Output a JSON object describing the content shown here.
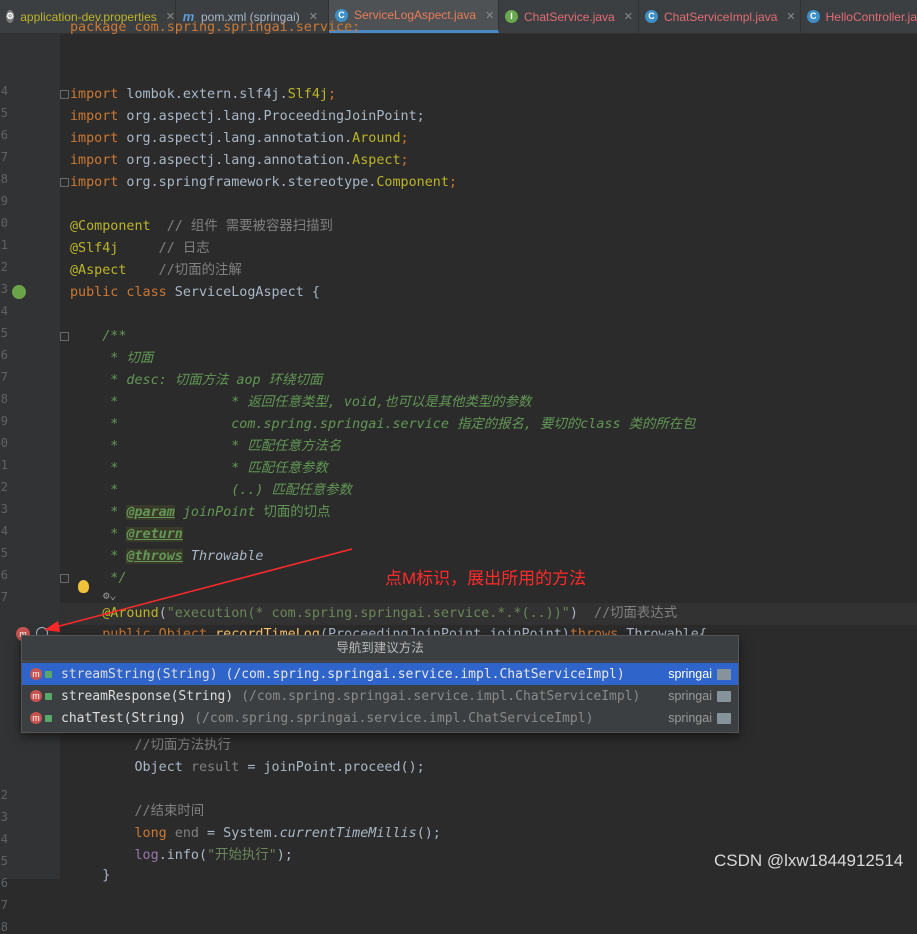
{
  "tabs": [
    {
      "label": "application-dev.properties",
      "color": "#bbb529",
      "icon": "gear-icon",
      "icon_text": "",
      "active": false
    },
    {
      "label": "pom.xml (springai)",
      "color": "#a9b7c6",
      "icon": "maven-icon",
      "icon_text": "m",
      "active": false
    },
    {
      "label": "ServiceLogAspect.java",
      "color": "#e87d59",
      "icon": "class-icon",
      "icon_text": "C",
      "active": true
    },
    {
      "label": "ChatService.java",
      "color": "#e06c75",
      "icon": "interface-icon",
      "icon_text": "I",
      "active": false
    },
    {
      "label": "ChatServiceImpl.java",
      "color": "#e06c75",
      "icon": "class-icon",
      "icon_text": "C",
      "active": false
    },
    {
      "label": "HelloController.ja",
      "color": "#e06c75",
      "icon": "class-icon",
      "icon_text": "C",
      "active": false
    }
  ],
  "gutter": {
    "line_numbers": [
      "",
      "",
      "",
      "4",
      "5",
      "6",
      "7",
      "8",
      "9",
      "0",
      "1",
      "2",
      "3",
      "4",
      "5",
      "6",
      "7",
      "8",
      "9",
      "0",
      "1",
      "2",
      "3",
      "4",
      "5",
      "6",
      "7",
      "",
      "",
      "",
      "",
      "",
      "",
      "",
      "",
      "2",
      "3",
      "4",
      "5",
      "6",
      "7",
      "8",
      ""
    ]
  },
  "code": {
    "line0": "package com.spring.springai.service;",
    "i1a": "import",
    "i1b": " lombok.extern.slf4j.",
    "i1c": "Slf4j",
    "i1d": ";",
    "i2a": "import",
    "i2b": " org.aspectj.lang.ProceedingJoinPoint;",
    "i3a": "import",
    "i3b": " org.aspectj.lang.annotation.",
    "i3c": "Around",
    "i3d": ";",
    "i4a": "import",
    "i4b": " org.aspectj.lang.annotation.",
    "i4c": "Aspect",
    "i4d": ";",
    "i5a": "import",
    "i5b": " org.springframework.stereotype.",
    "i5c": "Component",
    "i5d": ";",
    "a1a": "@Component",
    "a1b": "  // 组件 需要被容器扫描到",
    "a2a": "@Slf4j",
    "a2b": "     // 日志",
    "a3a": "@Aspect",
    "a3b": "    //切面的注解",
    "c1a": "public class",
    "c1b": " ServiceLogAspect {",
    "d1": "    /**",
    "d2": "     * 切面",
    "d3": "     * desc: 切面方法 aop 环绕切面",
    "d4": "     *              * 返回任意类型, void,也可以是其他类型的参数",
    "d5": "     *              com.spring.springai.service 指定的报名, 要切的class 类的所在包",
    "d6": "     *              * 匹配任意方法名",
    "d7": "     *              * 匹配任意参数",
    "d8": "     *              (..) 匹配任意参数",
    "d9a": "     * ",
    "d9b": "@param",
    "d9c": " joinPoint ",
    "d9d": "切面的切点",
    "d10a": "     * ",
    "d10b": "@return",
    "d11a": "     * ",
    "d11b": "@throws",
    "d11c": " Throwable",
    "d12": "     */",
    "ar_a": "    @Around",
    "ar_b": "(",
    "ar_c": "\"execution(* com.spring.springai.service.*.*(..))\"",
    "ar_d": ")  ",
    "ar_e": "//切面表达式",
    "sig_a": "    public Object ",
    "sig_b": "recordTimeLog",
    "sig_c": "(ProceedingJoinPoint joinPoint)",
    "sig_d": "throws",
    "sig_e": " Throwable{",
    "b1": "        //切面方法执行",
    "b2a": "        Object ",
    "b2b": "result",
    "b2c": " = joinPoint.proceed();",
    "b3": "        //结束时间",
    "b4a": "        long ",
    "b4b": "end",
    "b4c": " = System.",
    "b4d": "currentTimeMillis",
    "b4e": "();",
    "b5a": "        ",
    "b5b": "log",
    "b5c": ".info(",
    "b5d": "\"开始执行\"",
    "b5e": ");",
    "b6": "    }"
  },
  "popup": {
    "title": "导航到建议方法",
    "items": [
      {
        "name": "streamString(String)",
        "cls": "(/com.spring.springai.service.impl.ChatServiceImpl)",
        "module": "springai",
        "selected": true
      },
      {
        "name": "streamResponse(String)",
        "cls": "(/com.spring.springai.service.impl.ChatServiceImpl)",
        "module": "springai",
        "selected": false
      },
      {
        "name": "chatTest(String)",
        "cls": "(/com.spring.springai.service.impl.ChatServiceImpl)",
        "module": "springai",
        "selected": false
      }
    ]
  },
  "annotation": {
    "text": "点M标识，展出所用的方法",
    "color": "#ff2a2a"
  },
  "watermark": "CSDN @lxw1844912514",
  "inlay": "⚙⌄"
}
